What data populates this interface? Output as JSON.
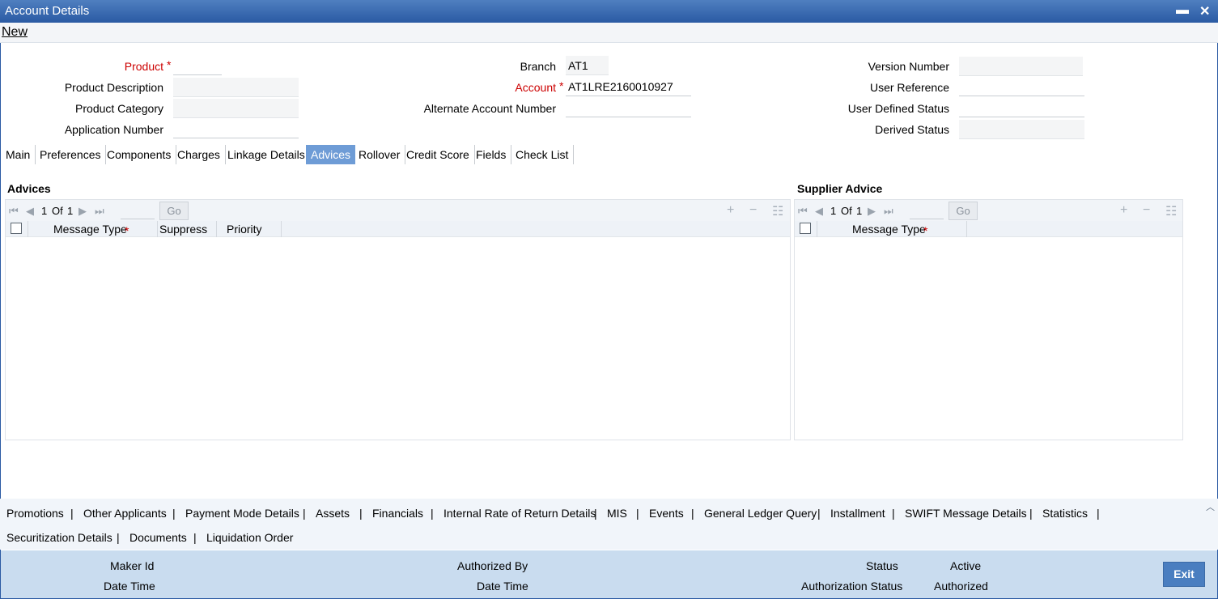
{
  "window": {
    "title": "Account Details",
    "minimize": "▬",
    "close": "✕"
  },
  "menu": {
    "new_label": "New"
  },
  "header": {
    "product_label": "Product",
    "product_value": "",
    "product_description_label": "Product Description",
    "product_category_label": "Product Category",
    "application_number_label": "Application Number",
    "branch_label": "Branch",
    "branch_value": "AT1",
    "account_label": "Account",
    "account_value": "AT1LRE2160010927",
    "alternate_account_label": "Alternate Account Number",
    "version_number_label": "Version Number",
    "user_reference_label": "User Reference",
    "user_defined_status_label": "User Defined Status",
    "derived_status_label": "Derived Status",
    "required_mark": "*"
  },
  "tabs": [
    "Main",
    "Preferences",
    "Components",
    "Charges",
    "Linkage Details",
    "Advices",
    "Rollover",
    "Credit Score",
    "Fields",
    "Check List"
  ],
  "active_tab": "Advices",
  "advices": {
    "title": "Advices",
    "pagination": {
      "current": "1",
      "of_label": "Of",
      "total": "1",
      "go_label": "Go"
    },
    "columns": [
      "Message Type",
      "Suppress",
      "Priority"
    ]
  },
  "supplier_advice": {
    "title": "Supplier Advice",
    "pagination": {
      "current": "1",
      "of_label": "Of",
      "total": "1",
      "go_label": "Go"
    },
    "columns": [
      "Message Type"
    ]
  },
  "bottom_links": {
    "row1": [
      "Promotions",
      "Other Applicants",
      "Payment Mode Details",
      "Assets",
      "Financials",
      "Internal Rate of Return Details",
      "MIS",
      "Events",
      "General Ledger Query",
      "Installment",
      "SWIFT Message Details",
      "Statistics"
    ],
    "row2": [
      "Securitization Details",
      "Documents",
      "Liquidation Order"
    ],
    "separator": "|"
  },
  "footer": {
    "maker_id_label": "Maker Id",
    "date_time_label": "Date Time",
    "authorized_by_label": "Authorized By",
    "date_time_label_2": "Date Time",
    "status_label": "Status",
    "status_value": "Active",
    "authorization_status_label": "Authorization Status",
    "authorization_status_value": "Authorized",
    "exit_label": "Exit"
  },
  "colors": {
    "title_bar": "#2a5aa3",
    "active_tab": "#6e9cd6",
    "footer_bg": "#c9dcef",
    "required": "#cc0000",
    "exit_button": "#4a7ec0"
  }
}
